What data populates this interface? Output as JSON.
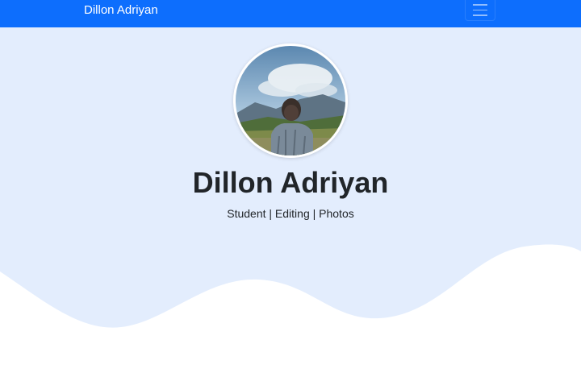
{
  "navbar": {
    "brand": "Dillon Adriyan",
    "toggler_icon": "hamburger-menu-icon",
    "bg_color": "#0d6efd"
  },
  "profile": {
    "name": "Dillon Adriyan",
    "tagline": "Student | Editing | Photos",
    "avatar": "profile-photo"
  },
  "colors": {
    "hero_bg": "#e3edfd",
    "wave": "#ffffff",
    "text": "#212529"
  }
}
